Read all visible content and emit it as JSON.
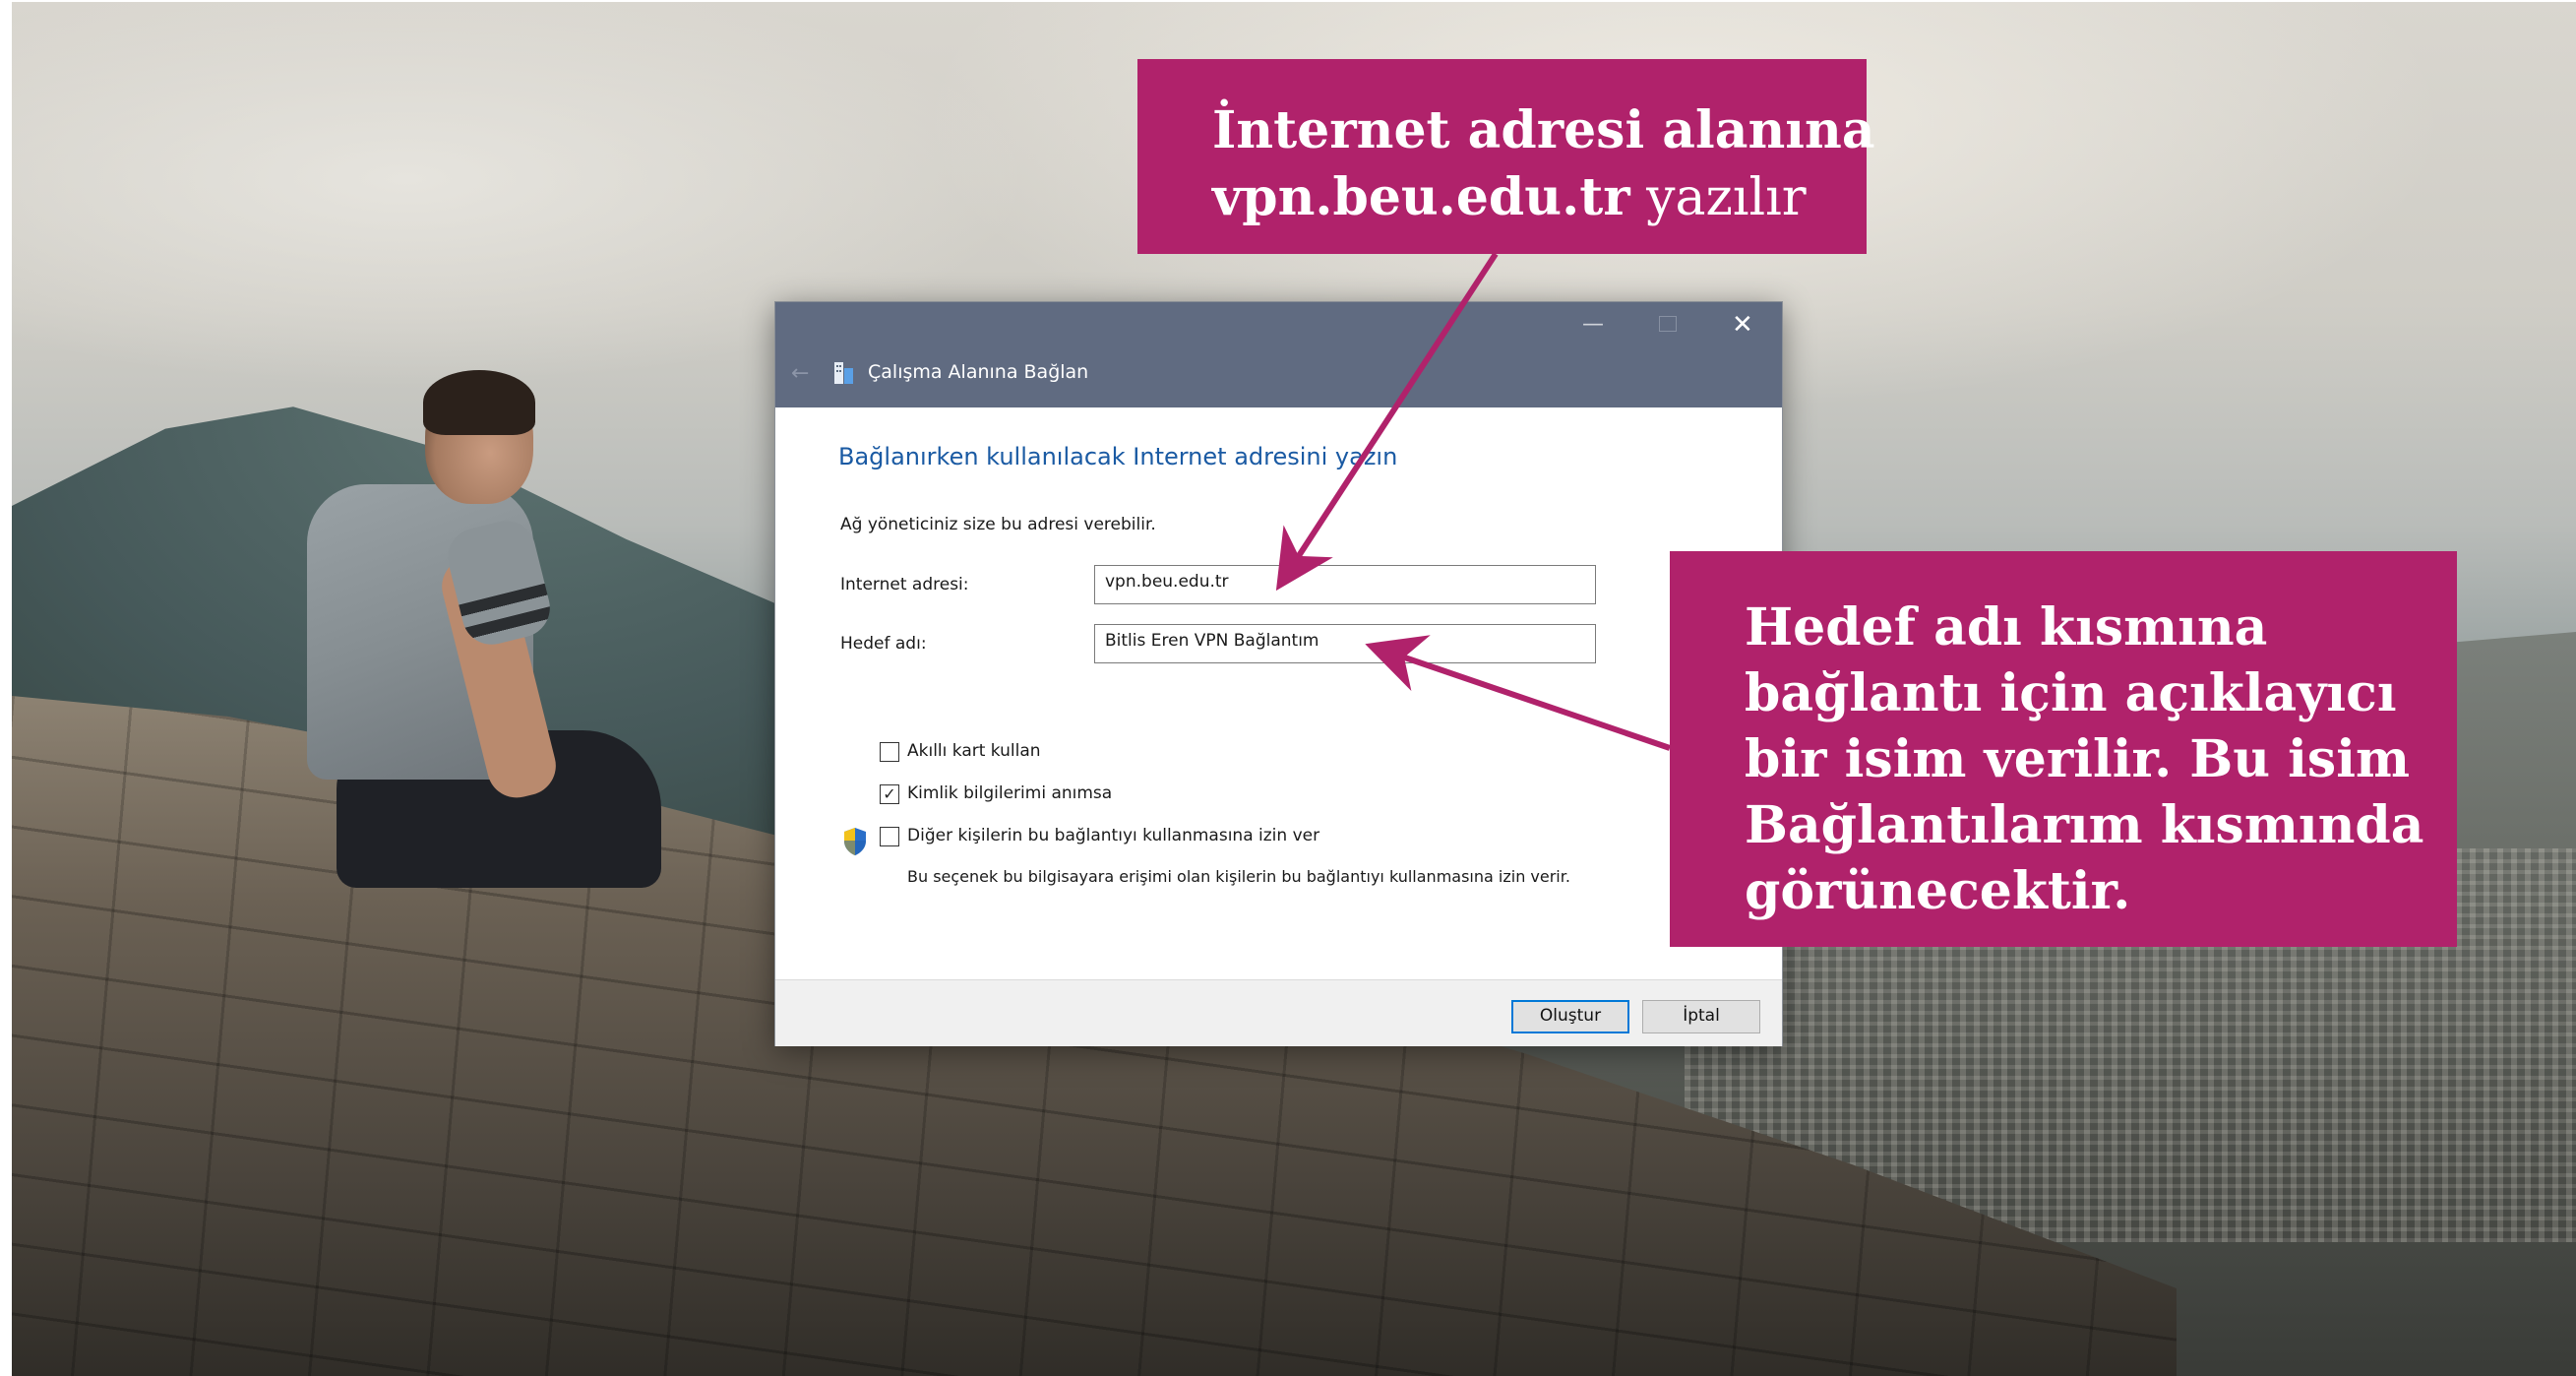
{
  "dialog": {
    "title": "Çalışma Alanına Bağlan",
    "back_symbol": "←",
    "minimize_symbol": "—",
    "close_symbol": "✕",
    "heading": "Bağlanırken kullanılacak Internet adresini yazın",
    "hint": "Ağ yöneticiniz size bu adresi verebilir.",
    "fields": [
      {
        "label": "Internet adresi:",
        "value": "vpn.beu.edu.tr"
      },
      {
        "label": "Hedef adı:",
        "value": "Bitlis Eren VPN Bağlantım"
      }
    ],
    "checkboxes": [
      {
        "label": "Akıllı kart kullan",
        "checked": false
      },
      {
        "label": "Kimlik bilgilerimi anımsa",
        "checked": true
      },
      {
        "label": "Diğer kişilerin bu bağlantıyı kullanmasına izin ver",
        "checked": false
      }
    ],
    "check_mark": "✓",
    "note": "Bu seçenek bu bilgisayara erişimi olan kişilerin bu bağlantıyı kullanmasına izin verir.",
    "buttons": {
      "create": "Oluştur",
      "cancel": "İptal"
    }
  },
  "callouts": {
    "top": {
      "line1": "İnternet adresi alanına",
      "line2_bold": "vpn.beu.edu.tr",
      "line2_rest": " yazılır"
    },
    "right": {
      "text": "Hedef adı kısmına bağlantı için açıklayıcı bir isim verilir. Bu isim Bağlantılarım kısmında görünecektir."
    }
  },
  "colors": {
    "callout": "#b0226b",
    "titlebar": "#606b81",
    "heading": "#1a5aa3",
    "primary_border": "#0078d7"
  },
  "icons": [
    "back-arrow-icon",
    "workplace-connection-icon",
    "minimize-icon",
    "maximize-icon",
    "close-icon",
    "uac-shield-icon",
    "checkmark-icon"
  ]
}
